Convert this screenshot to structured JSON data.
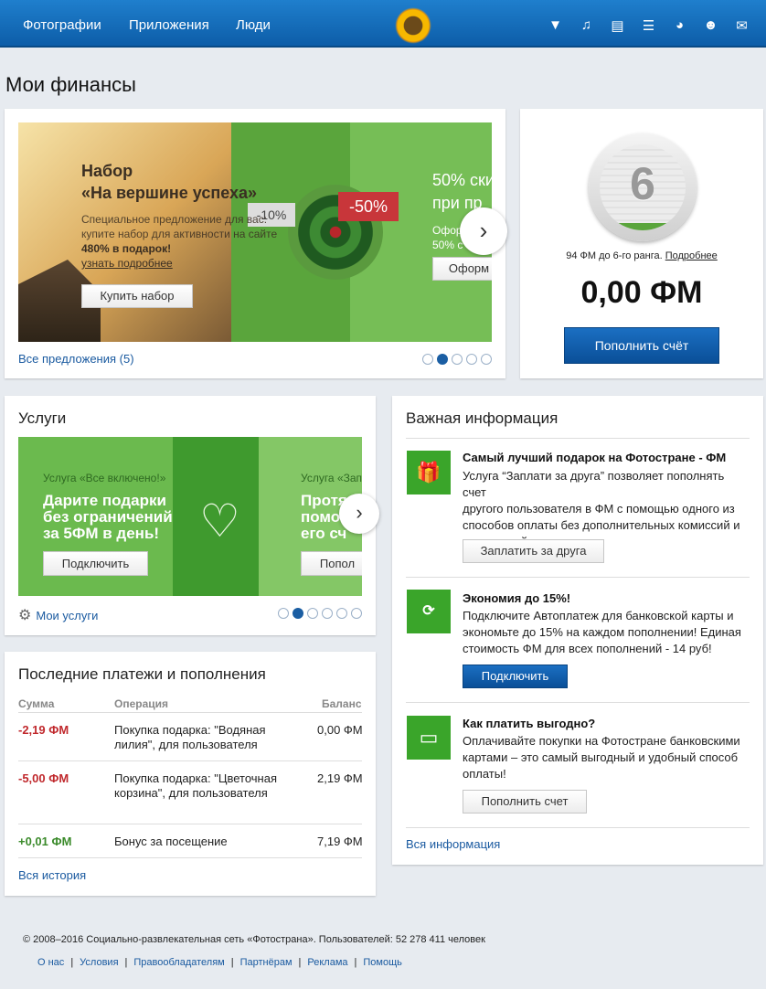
{
  "topnav": {
    "items": [
      "Фотографии",
      "Приложения",
      "Люди"
    ],
    "icons": [
      "diamond-icon",
      "music-icon",
      "news-icon",
      "list-icon",
      "pacman-icon",
      "people-icon",
      "mail-icon"
    ]
  },
  "page_title": "Мои финансы",
  "promo": {
    "heading1": "Набор",
    "heading2": "«На вершине успеха»",
    "desc1": "Специальное предложение для вас:",
    "desc2": "купите набор для активности на сайте",
    "bonus": "480% в подарок!",
    "more_link": "узнать подробнее",
    "buy_button": "Купить набор",
    "badge_small": "-10%",
    "badge_big": "-50%",
    "slide2_title1": "50% ски",
    "slide2_title2": "при пр",
    "slide2_text1": "Офор",
    "slide2_text2": "50% с",
    "slide2_button": "Оформ",
    "all_offers": "Все предложения (5)",
    "dots": 5,
    "active_dot": 1
  },
  "rank": {
    "number": "6",
    "caption": "94 ФМ до 6-го ранга.",
    "caption_link": "Подробнее",
    "balance": "0,00 ФМ",
    "topup_button": "Пополнить счёт",
    "progress": 0.08
  },
  "services": {
    "title": "Услуги",
    "label1": "Услуга «Все включено!»",
    "heading1": "Дарите подарки",
    "heading2": "без ограничений",
    "heading3": "за 5ФМ в день!",
    "button": "Подключить",
    "label2": "Услуга «Зап",
    "s2_line1": "Протя",
    "s2_line2": "помо",
    "s2_line3": "его сч",
    "s2_button": "Попол",
    "my_services": "Мои услуги",
    "dots": 6,
    "active_dot": 1
  },
  "payments": {
    "title": "Последние платежи и пополнения",
    "columns": [
      "Сумма",
      "Операция",
      "Баланс"
    ],
    "rows": [
      {
        "amount": "-2,19 ФМ",
        "op1": "Покупка подарка: \"Водяная",
        "op2": "лилия\", для пользователя",
        "balance": "0,00 ФМ",
        "type": "neg"
      },
      {
        "amount": "-5,00 ФМ",
        "op1": "Покупка подарка: \"Цветочная",
        "op2": "корзина\", для пользователя",
        "balance": "2,19 ФМ",
        "type": "neg"
      },
      {
        "amount": "+0,01 ФМ",
        "op1": "Бонус за посещение",
        "op2": "",
        "balance": "7,19 ФМ",
        "type": "pos"
      }
    ],
    "history_link": "Вся история"
  },
  "info": {
    "title": "Важная информация",
    "items": [
      {
        "title": "Самый лучший подарок на Фотостране - ФМ",
        "lines": [
          "Услуга “Заплати за друга” позволяет пополнять счет",
          "другого пользователя в ФМ с помощью одного из",
          "способов оплаты без дополнительных комиссий и",
          "начислений."
        ],
        "button": "Заплатить за друга",
        "icon": "gift-card-icon"
      },
      {
        "title": "Экономия до 15%!",
        "lines": [
          "Подключите Автоплатеж для банковской карты и",
          "экономьте до 15% на каждом пополнении! Единая",
          "стоимость ФМ для всех пополнений - 14 руб!"
        ],
        "button": "Подключить",
        "icon": "fm-refresh-icon"
      },
      {
        "title": "Как платить выгодно?",
        "lines": [
          "Оплачивайте покупки на Фотостране банковскими",
          "картами – это самый выгодный и удобный способ",
          "оплаты!"
        ],
        "button": "Пополнить счет",
        "icon": "bank-card-icon"
      }
    ],
    "all_link": "Вся информация"
  },
  "footer": {
    "copyright": "© 2008–2016 Социально-развлекательная сеть «Фотострана». Пользователей: 52 278 411 человек",
    "links": [
      "О нас",
      "Условия",
      "Правообладателям",
      "Партнёрам",
      "Реклама",
      "Помощь"
    ]
  }
}
